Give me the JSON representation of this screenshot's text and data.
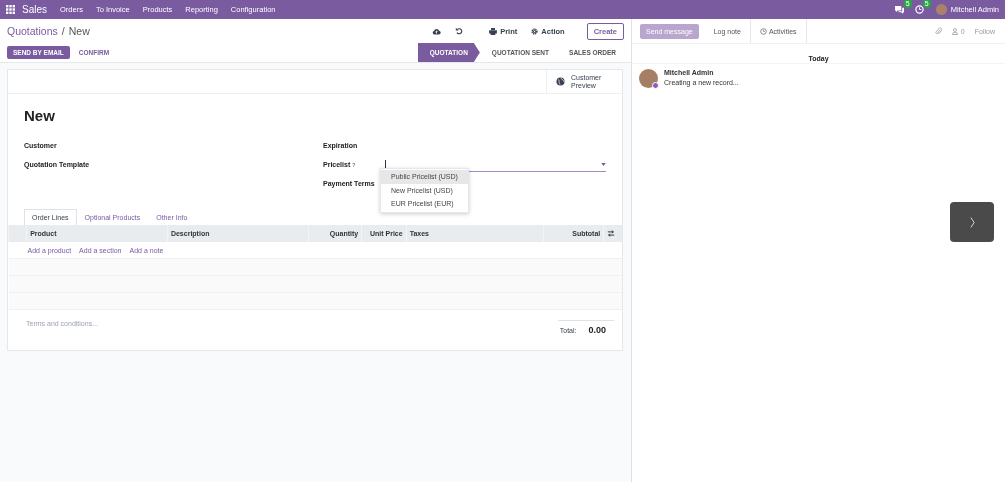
{
  "navbar": {
    "app": "Sales",
    "menus": [
      "Orders",
      "To Invoice",
      "Products",
      "Reporting",
      "Configuration"
    ],
    "messages_badge": "5",
    "activities_badge": "5",
    "user": "Mitchell Admin"
  },
  "breadcrumb": {
    "parent": "Quotations",
    "separator": "/",
    "current": "New"
  },
  "toolbar": {
    "print": "Print",
    "action": "Action",
    "create": "Create"
  },
  "buttons": [
    {
      "label": "SEND BY EMAIL",
      "kind": "primary"
    },
    {
      "label": "CONFIRM",
      "kind": "secondary"
    }
  ],
  "statusbar": [
    {
      "label": "QUOTATION",
      "selected": true
    },
    {
      "label": "QUOTATION SENT",
      "selected": false
    },
    {
      "label": "SALES ORDER",
      "selected": false
    }
  ],
  "sheet": {
    "smart_button": "Customer Preview",
    "title": "New",
    "fields_left": [
      {
        "label": "Customer"
      },
      {
        "label": "Quotation Template"
      }
    ],
    "fields_right": [
      {
        "label": "Expiration",
        "focused": false
      },
      {
        "label": "Pricelist",
        "help": "?",
        "focused": true
      },
      {
        "label": "Payment Terms",
        "focused": false
      }
    ],
    "dropdown": [
      {
        "label": "Public Pricelist (USD)",
        "selected": true
      },
      {
        "label": "New Pricelist (USD)",
        "selected": false
      },
      {
        "label": "EUR Pricelist (EUR)",
        "selected": false
      }
    ],
    "tabs": [
      {
        "label": "Order Lines",
        "selected": true
      },
      {
        "label": "Optional Products",
        "selected": false
      },
      {
        "label": "Other Info",
        "selected": false
      }
    ],
    "columns": [
      "Product",
      "Description",
      "Quantity",
      "Unit Price",
      "Taxes",
      "Subtotal"
    ],
    "add_links": [
      "Add a product",
      "Add a section",
      "Add a note"
    ],
    "terms_placeholder": "Terms and conditions...",
    "total_label": "Total:",
    "total": "0.00"
  },
  "chatter": {
    "actions": [
      {
        "label": "Send message",
        "selected": true
      },
      {
        "label": "Log note",
        "selected": false
      },
      {
        "label": "Activities",
        "selected": false
      }
    ],
    "followers": "0",
    "follow": "Follow",
    "date": "Today",
    "messages": [
      {
        "author": "Mitchell Admin",
        "body": "Creating a new record..."
      }
    ]
  }
}
